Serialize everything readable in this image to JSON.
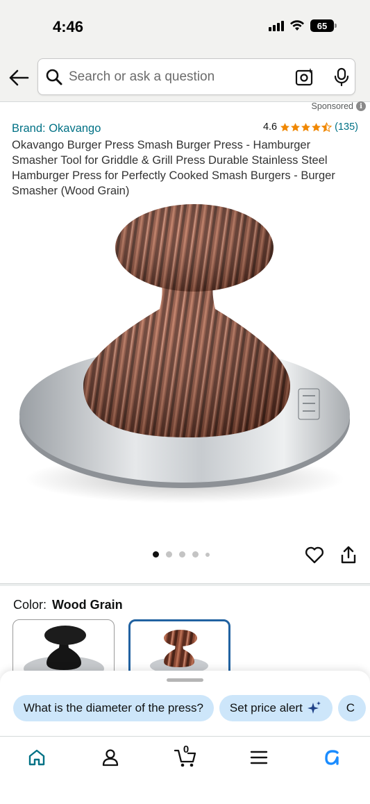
{
  "status_bar": {
    "time": "4:46",
    "battery": "65"
  },
  "search": {
    "placeholder": "Search or ask a question",
    "icons": [
      "back-arrow-icon",
      "search-icon",
      "camera-icon",
      "microphone-icon"
    ]
  },
  "sponsored": {
    "label": "Sponsored",
    "info_glyph": "i"
  },
  "product": {
    "brand": "Brand: Okavango",
    "rating": "4.6",
    "stars": 4.6,
    "star_color": "#f08804",
    "rating_count": "(135)",
    "title": "Okavango Burger Press Smash Burger Press - Hamburger Smasher Tool for Griddle & Grill Press Durable Stainless Steel Hamburger Press for Perfectly Cooked Smash Burgers - Burger Smasher (Wood Grain)",
    "image_count": 5,
    "active_image": 1
  },
  "color": {
    "label": "Color:",
    "selected": "Wood Grain",
    "options": [
      {
        "name": "black-handle-swatch",
        "selected": false
      },
      {
        "name": "wood-grain-swatch",
        "selected": true
      }
    ]
  },
  "suggestions": {
    "chips": [
      {
        "label": "What is the diameter of the press?"
      },
      {
        "label": "Set price alert",
        "icon": "sparkle-icon"
      },
      {
        "label": "C"
      }
    ]
  },
  "tab_bar": {
    "cart_count": "0",
    "tabs": [
      "home-icon",
      "account-icon",
      "cart-icon",
      "menu-icon",
      "rufus-icon"
    ],
    "active_color": "#007185",
    "rufus_color": "#1a8cff"
  },
  "colors": {
    "link": "#007185",
    "chip_bg": "#cde6fa",
    "selected_border": "#2162a1"
  }
}
